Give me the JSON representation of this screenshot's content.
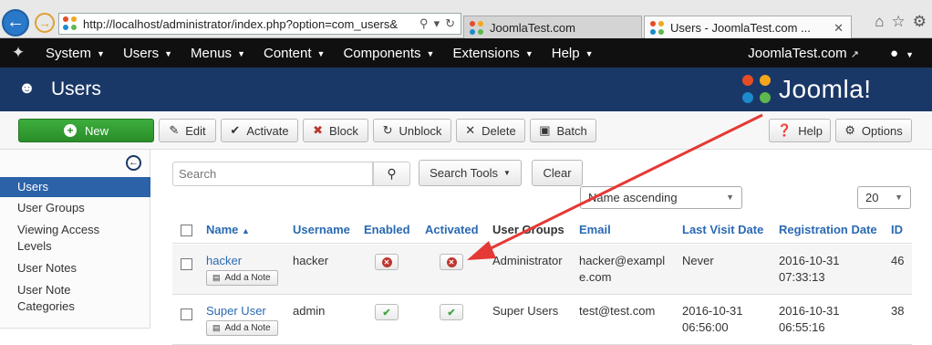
{
  "browser": {
    "url": "http://localhost/administrator/index.php?option=com_users&",
    "tabs": [
      {
        "title": "JoomlaTest.com"
      },
      {
        "title": "Users - JoomlaTest.com ..."
      }
    ]
  },
  "admin_nav": {
    "items": [
      {
        "label": "System"
      },
      {
        "label": "Users"
      },
      {
        "label": "Menus"
      },
      {
        "label": "Content"
      },
      {
        "label": "Components"
      },
      {
        "label": "Extensions"
      },
      {
        "label": "Help"
      }
    ],
    "site_link": "JoomlaTest.com"
  },
  "header": {
    "title": "Users",
    "brand": "Joomla!"
  },
  "toolbar": {
    "new": "New",
    "edit": "Edit",
    "activate": "Activate",
    "block": "Block",
    "unblock": "Unblock",
    "delete": "Delete",
    "batch": "Batch",
    "help": "Help",
    "options": "Options"
  },
  "sidebar": {
    "items": [
      {
        "label": "Users",
        "active": true
      },
      {
        "label": "User Groups"
      },
      {
        "label": "Viewing Access Levels"
      },
      {
        "label": "User Notes"
      },
      {
        "label": "User Note Categories"
      }
    ]
  },
  "filters": {
    "search_placeholder": "Search",
    "search_tools": "Search Tools",
    "clear": "Clear",
    "ordering": "Name ascending",
    "limit": "20"
  },
  "table": {
    "columns": [
      "Name",
      "Username",
      "Enabled",
      "Activated",
      "User Groups",
      "Email",
      "Last Visit Date",
      "Registration Date",
      "ID"
    ],
    "add_note_label": "Add a Note",
    "rows": [
      {
        "name": "hacker",
        "username": "hacker",
        "enabled": "blocked",
        "activated": "not activated",
        "groups": "Administrator",
        "email": [
          "hacker@exampl",
          "e.com"
        ],
        "last_visit": "Never",
        "registered": [
          "2016-10-31",
          "07:33:13"
        ],
        "id": "46"
      },
      {
        "name": "Super User",
        "username": "admin",
        "enabled": "enabled",
        "activated": "activated",
        "groups": "Super Users",
        "email": [
          "test@test.com"
        ],
        "last_visit": [
          "2016-10-31",
          "06:56:00"
        ],
        "registered": [
          "2016-10-31",
          "06:55:16"
        ],
        "id": "38"
      }
    ]
  },
  "colors": {
    "header_bg": "#1a3867",
    "nav_bg": "#101010",
    "link": "#2a69b3",
    "new_button": "#2a8e2a",
    "annotation_arrow": "#e53935"
  }
}
